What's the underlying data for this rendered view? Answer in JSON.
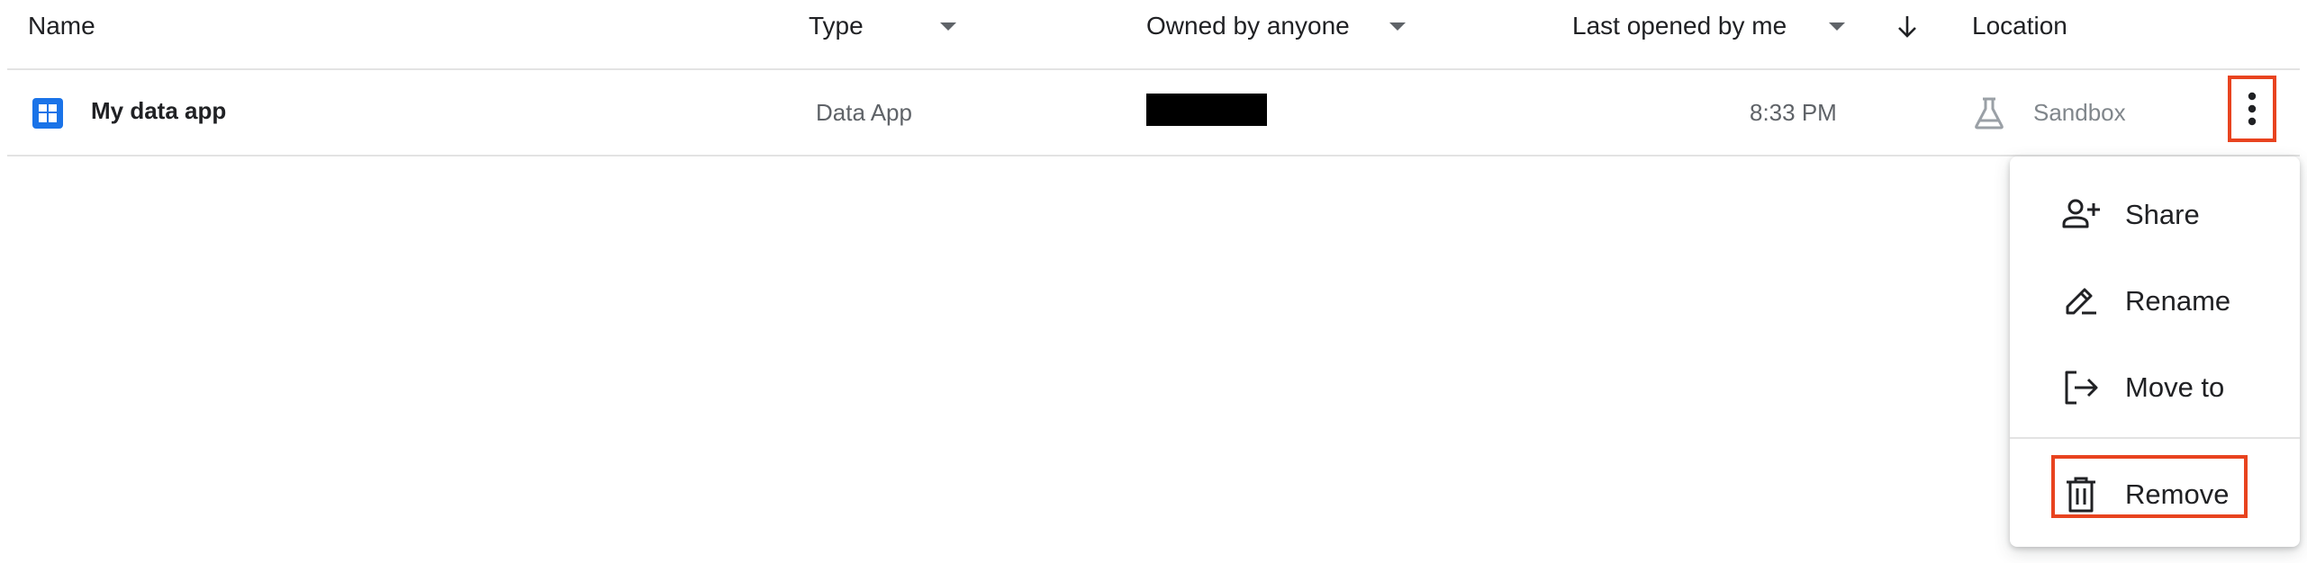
{
  "columns": {
    "name": "Name",
    "type": "Type",
    "owner": "Owned by anyone",
    "last_opened": "Last opened by me",
    "location": "Location"
  },
  "rows": [
    {
      "name": "My data app",
      "type": "Data App",
      "owner": "",
      "last_opened": "8:33 PM",
      "location": "Sandbox",
      "icon": "data-app-icon",
      "location_icon": "flask-icon"
    }
  ],
  "menu": {
    "items": [
      {
        "label": "Share",
        "icon": "person-add-icon"
      },
      {
        "label": "Rename",
        "icon": "pencil-icon"
      },
      {
        "label": "Move to",
        "icon": "move-to-icon"
      },
      {
        "label": "Remove",
        "icon": "trash-icon"
      }
    ]
  },
  "colors": {
    "accent_blue": "#1a73e8",
    "highlight": "#e8431f",
    "text": "#202124",
    "muted": "#5f6368",
    "divider": "#e3e3e3"
  }
}
